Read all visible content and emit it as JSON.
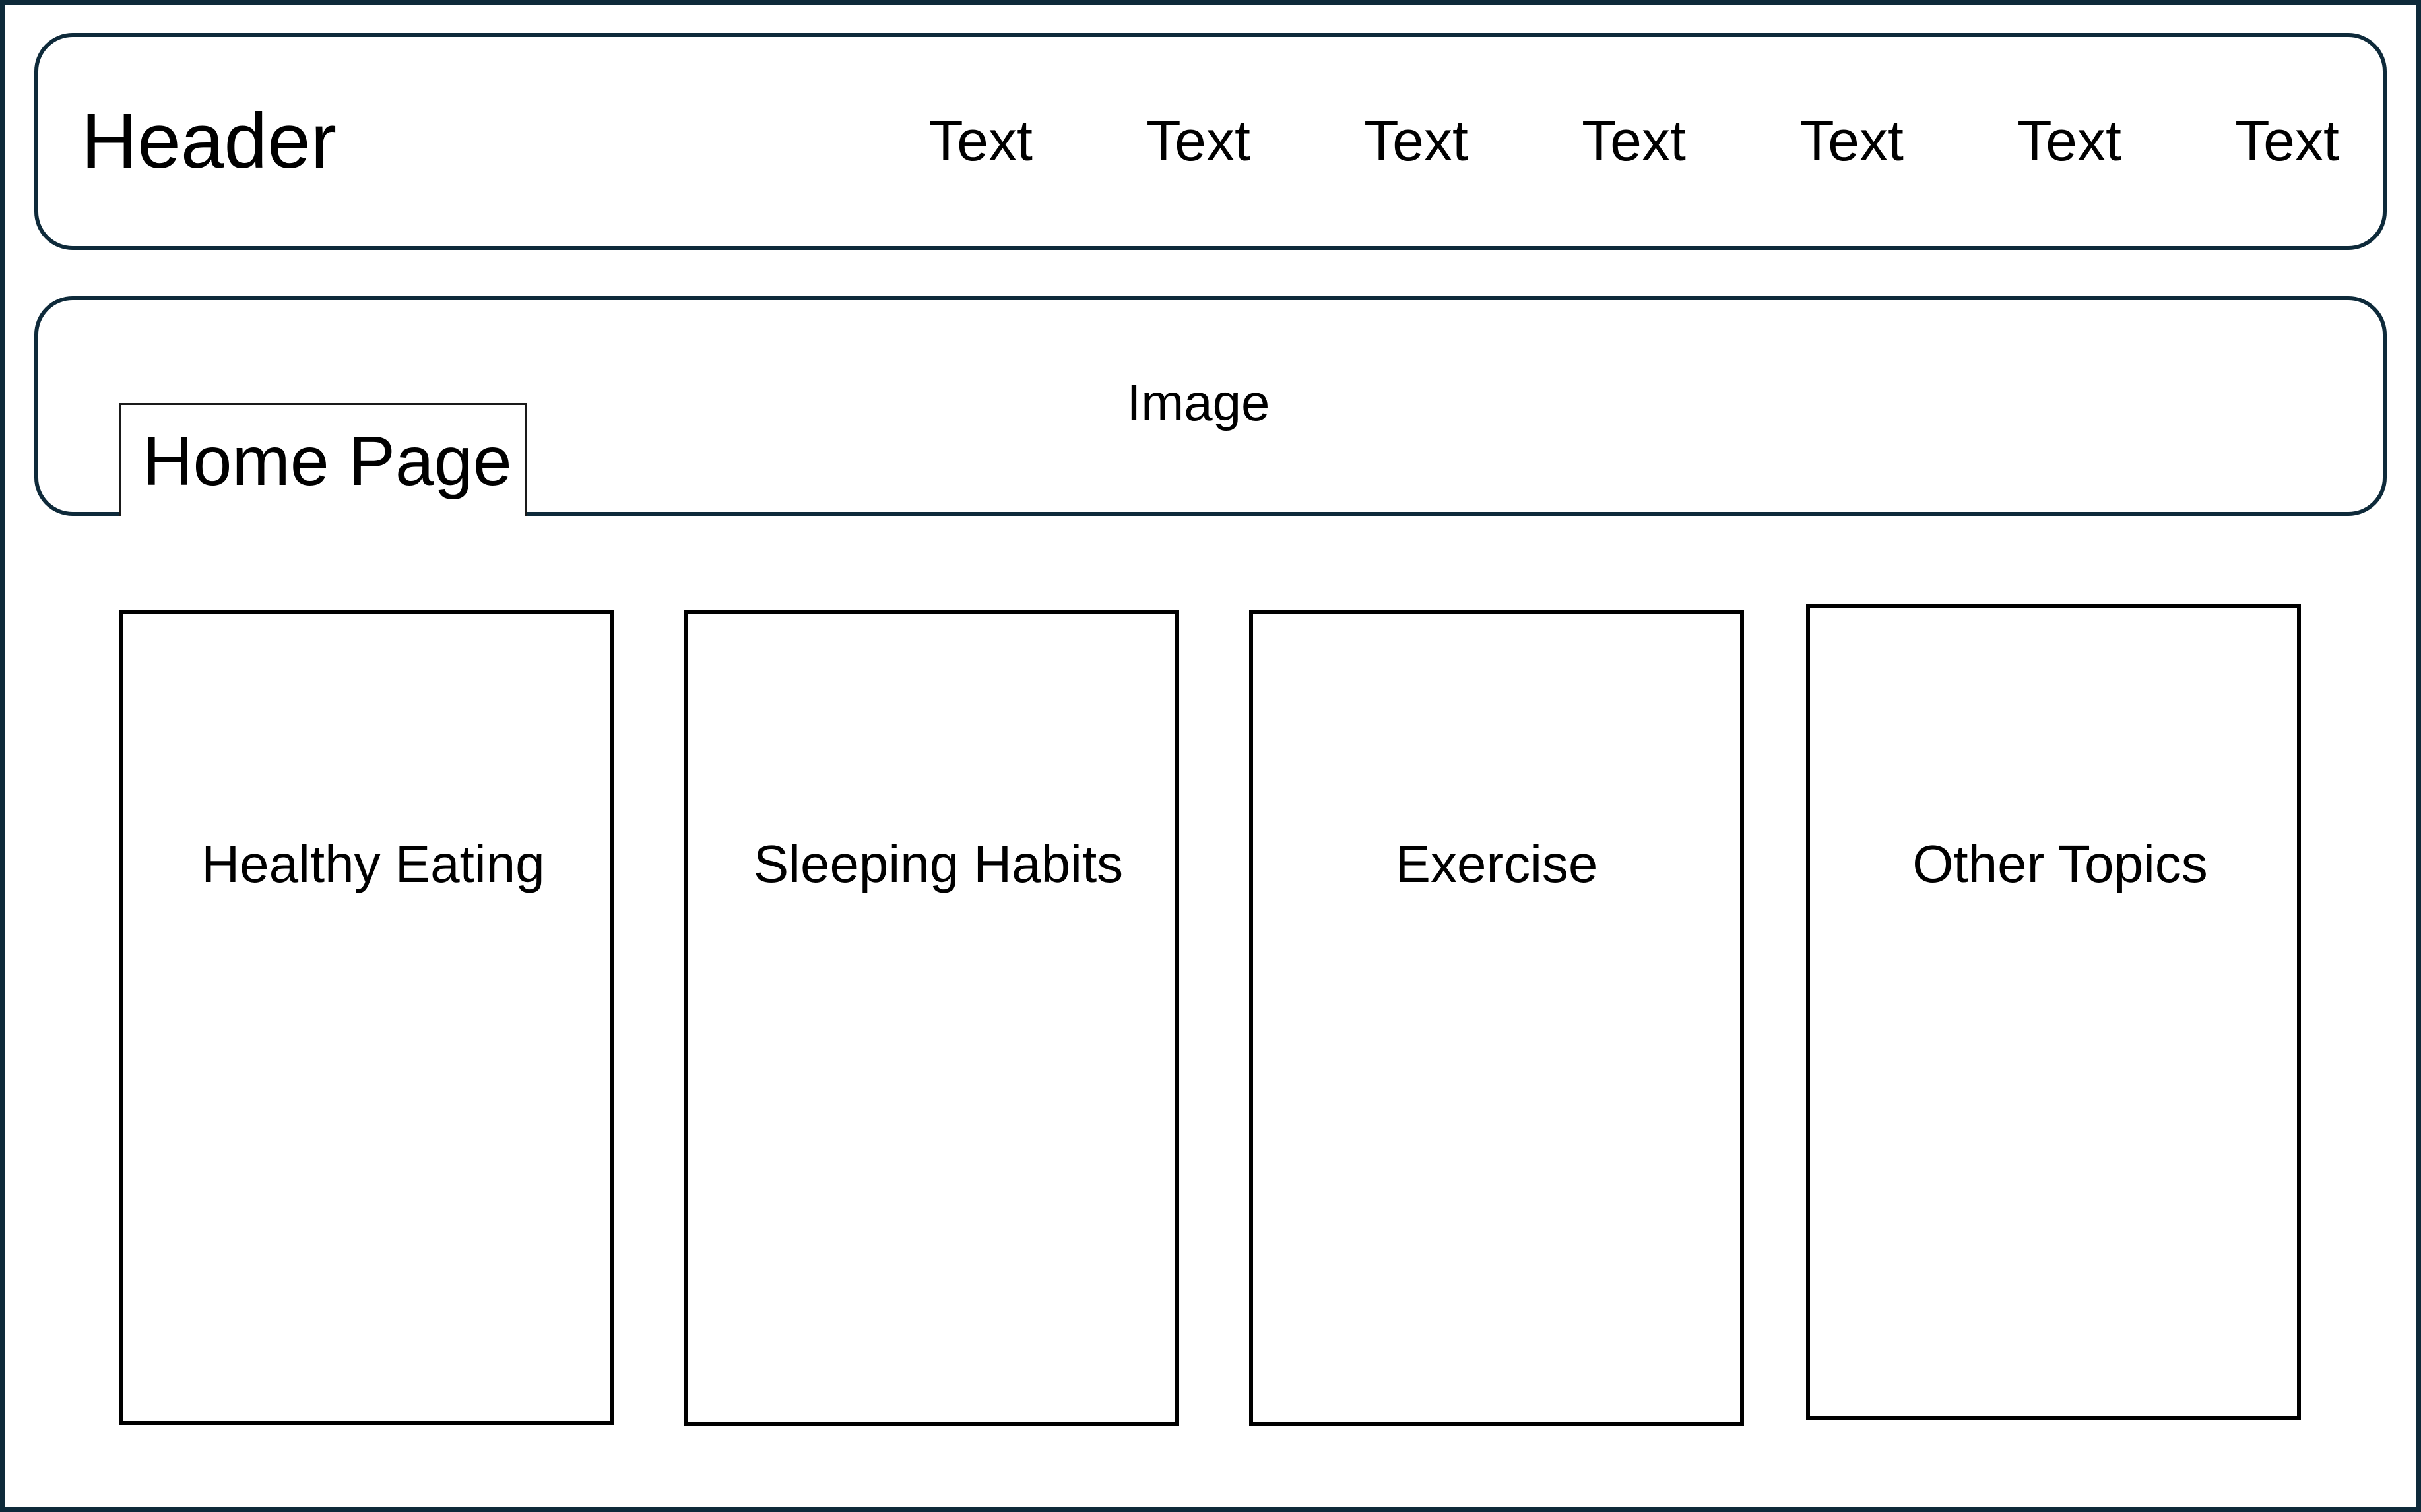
{
  "header": {
    "title": "Header",
    "nav_items": [
      "Text",
      "Text",
      "Text",
      "Text",
      "Text",
      "Text",
      "Text"
    ]
  },
  "hero": {
    "image_label": "Image",
    "page_title": "Home Page"
  },
  "topics": [
    {
      "label": "Healthy Eating"
    },
    {
      "label": "Sleeping Habits"
    },
    {
      "label": "Exercise"
    },
    {
      "label": "Other Topics"
    }
  ],
  "colors": {
    "frame_border": "#0e2a3a",
    "card_border": "#000000",
    "background": "#ffffff"
  }
}
